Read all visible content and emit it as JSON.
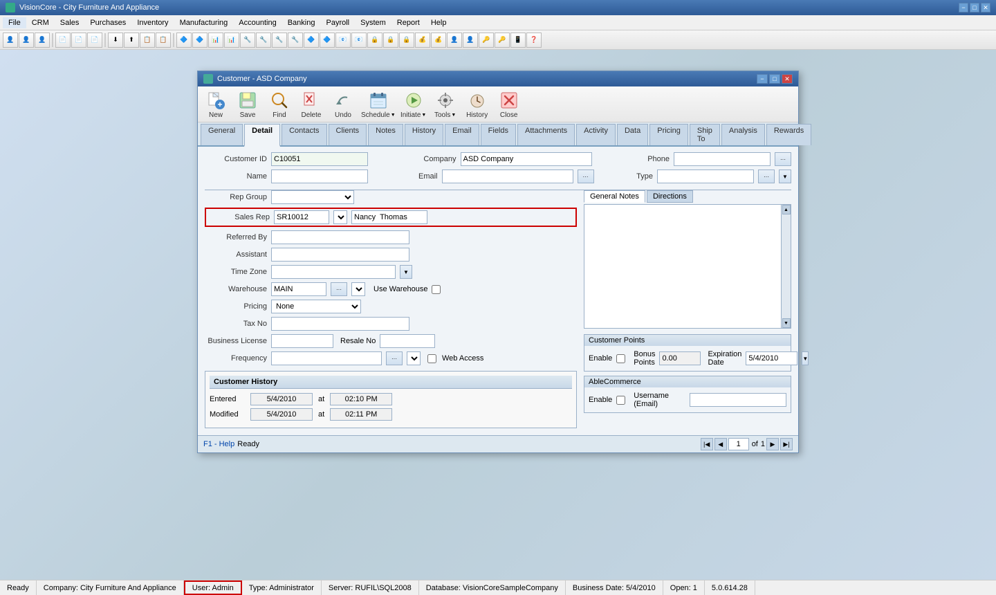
{
  "app": {
    "title": "VisionCore - City Furniture And Appliance",
    "icon": "vc"
  },
  "titlebar": {
    "minimize": "−",
    "maximize": "□",
    "close": "✕"
  },
  "menubar": {
    "items": [
      "File",
      "CRM",
      "Sales",
      "Purchases",
      "Inventory",
      "Manufacturing",
      "Accounting",
      "Banking",
      "Payroll",
      "System",
      "Report",
      "Help"
    ]
  },
  "dialog": {
    "title": "Customer - ASD Company",
    "minimize": "−",
    "maximize": "□",
    "close": "✕"
  },
  "dialog_toolbar": {
    "items": [
      {
        "label": "New",
        "icon": "new"
      },
      {
        "label": "Save",
        "icon": "save"
      },
      {
        "label": "Find",
        "icon": "find"
      },
      {
        "label": "Delete",
        "icon": "delete"
      },
      {
        "label": "Undo",
        "icon": "undo"
      },
      {
        "label": "Schedule",
        "icon": "schedule"
      },
      {
        "label": "Initiate",
        "icon": "initiate"
      },
      {
        "label": "Tools",
        "icon": "tools"
      },
      {
        "label": "History",
        "icon": "history"
      },
      {
        "label": "Close",
        "icon": "close"
      }
    ]
  },
  "tabs": {
    "items": [
      "General",
      "Detail",
      "Contacts",
      "Clients",
      "Notes",
      "History",
      "Email",
      "Fields",
      "Attachments",
      "Activity",
      "Data",
      "Pricing",
      "Ship To",
      "Analysis",
      "Rewards"
    ],
    "active": "Detail"
  },
  "form": {
    "customer_id_label": "Customer ID",
    "customer_id_value": "C10051",
    "company_label": "Company",
    "company_value": "ASD Company",
    "phone_label": "Phone",
    "phone_value": "",
    "name_label": "Name",
    "name_value": "",
    "email_label": "Email",
    "email_value": "",
    "type_label": "Type",
    "type_value": "",
    "rep_group_label": "Rep Group",
    "rep_group_value": "",
    "sales_rep_label": "Sales Rep",
    "sales_rep_id": "SR10012",
    "sales_rep_name": "Nancy  Thomas",
    "referred_by_label": "Referred By",
    "referred_by_value": "",
    "assistant_label": "Assistant",
    "assistant_value": "",
    "time_zone_label": "Time Zone",
    "time_zone_value": "",
    "warehouse_label": "Warehouse",
    "warehouse_value": "MAIN",
    "use_warehouse_label": "Use Warehouse",
    "pricing_label": "Pricing",
    "pricing_value": "None",
    "tax_no_label": "Tax No",
    "tax_no_value": "",
    "business_license_label": "Business License",
    "business_license_value": "",
    "resale_no_label": "Resale No",
    "resale_no_value": "",
    "frequency_label": "Frequency",
    "frequency_value": "",
    "web_access_label": "Web Access"
  },
  "customer_history": {
    "title": "Customer History",
    "entered_label": "Entered",
    "entered_date": "5/4/2010",
    "entered_at": "at",
    "entered_time": "02:10 PM",
    "modified_label": "Modified",
    "modified_date": "5/4/2010",
    "modified_at": "at",
    "modified_time": "02:11 PM"
  },
  "notes": {
    "tab1": "General Notes",
    "tab2": "Directions",
    "active": "General Notes",
    "content": ""
  },
  "customer_points": {
    "title": "Customer Points",
    "enable_label": "Enable",
    "bonus_points_label": "Bonus Points",
    "bonus_points_value": "0.00",
    "expiration_date_label": "Expiration Date",
    "expiration_date_value": "5/4/2010"
  },
  "able_commerce": {
    "title": "AbleCommerce",
    "enable_label": "Enable",
    "username_label": "Username (Email)",
    "username_value": ""
  },
  "bottom_bar": {
    "help": "F1 - Help",
    "status": "Ready",
    "page_current": "1",
    "page_total": "1"
  },
  "status_bar": {
    "ready": "Ready",
    "company": "Company: City Furniture And Appliance",
    "user": "User: Admin",
    "type": "Type: Administrator",
    "server": "Server: RUFIL\\SQL2008",
    "database": "Database: VisionCoreSampleCompany",
    "business_date": "Business Date: 5/4/2010",
    "open": "Open: 1",
    "version": "5.0.614.28"
  }
}
